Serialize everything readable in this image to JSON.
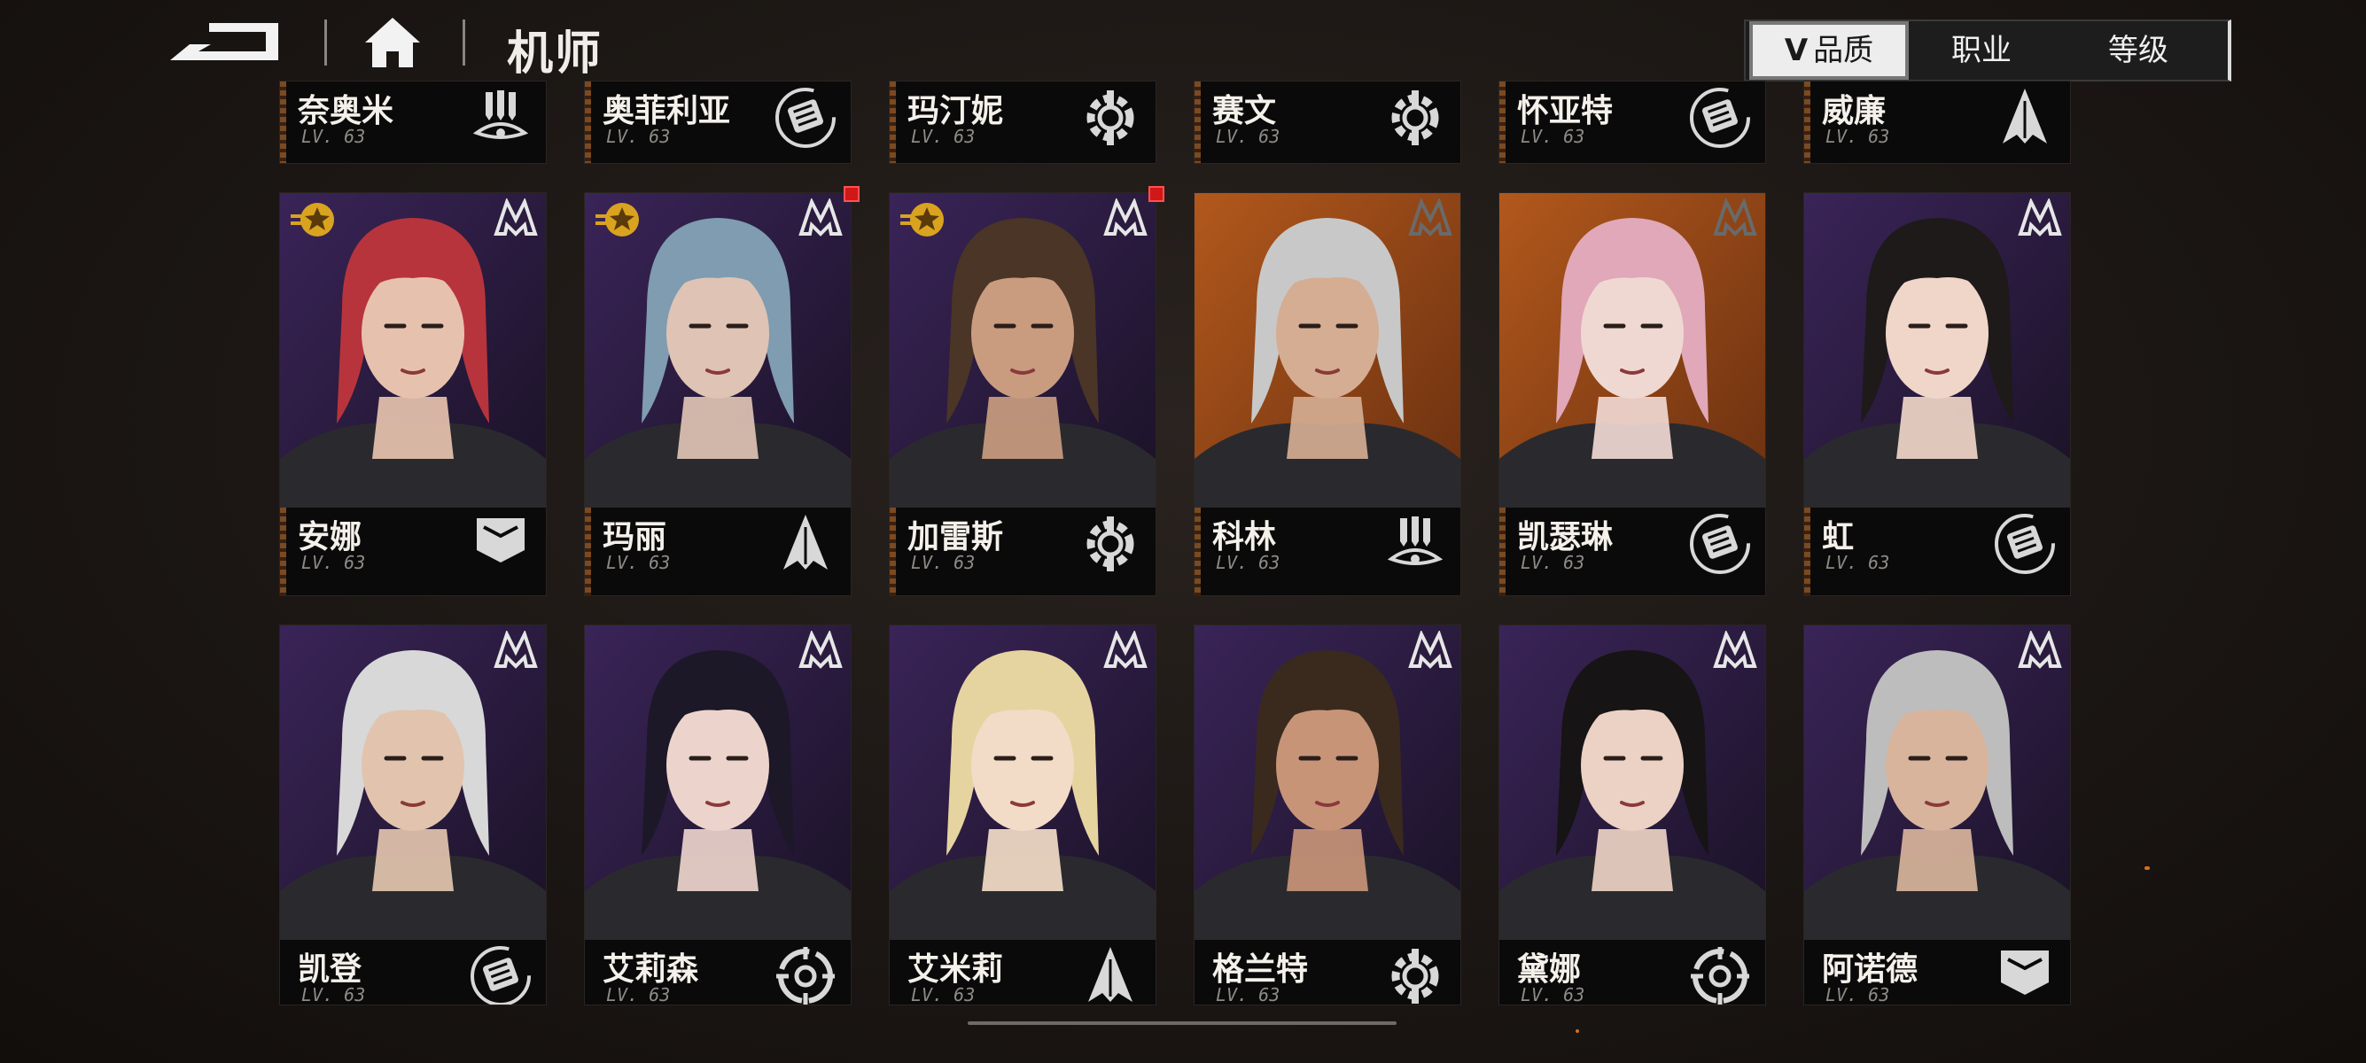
{
  "header": {
    "title": "机师",
    "back_icon": "back-arrow-icon",
    "home_icon": "home-icon"
  },
  "sort": {
    "tabs": [
      {
        "label": "品质",
        "active": true,
        "indicator": "V"
      },
      {
        "label": "职业",
        "active": false
      },
      {
        "label": "等级",
        "active": false
      }
    ]
  },
  "colors": {
    "purple_bg": "#3a2458",
    "orange_bg": "#b2581c",
    "gold_rank": "#d9a320",
    "alert_red": "#d01818"
  },
  "roster": {
    "row1": [
      {
        "name": "奈奥米",
        "level": "LV. 63",
        "class_icon": "triple-missile-icon"
      },
      {
        "name": "奥菲利亚",
        "level": "LV. 63",
        "class_icon": "fist-icon"
      },
      {
        "name": "玛汀妮",
        "level": "LV. 63",
        "class_icon": "wrench-gear-icon"
      },
      {
        "name": "赛文",
        "level": "LV. 63",
        "class_icon": "wrench-gear-icon"
      },
      {
        "name": "怀亚特",
        "level": "LV. 63",
        "class_icon": "fist-icon"
      },
      {
        "name": "威廉",
        "level": "LV. 63",
        "class_icon": "spike-icon"
      }
    ],
    "row2": [
      {
        "name": "安娜",
        "level": "LV. 63",
        "class_icon": "shield-chevron-icon",
        "rank_star": true,
        "new": false,
        "bg": "purple",
        "hair": "#b8343c",
        "skin": "#e6c2ae"
      },
      {
        "name": "玛丽",
        "level": "LV. 63",
        "class_icon": "spike-icon",
        "rank_star": true,
        "new": true,
        "bg": "purple",
        "hair": "#7f9cb0",
        "skin": "#dfc3b4"
      },
      {
        "name": "加雷斯",
        "level": "LV. 63",
        "class_icon": "wrench-gear-icon",
        "rank_star": true,
        "new": true,
        "bg": "purple",
        "hair": "#4a3526",
        "skin": "#c99c80"
      },
      {
        "name": "科林",
        "level": "LV. 63",
        "class_icon": "triple-missile-icon",
        "rank_star": false,
        "new": false,
        "bg": "orange",
        "hair": "#c8c8c8",
        "skin": "#d4ad92"
      },
      {
        "name": "凯瑟琳",
        "level": "LV. 63",
        "class_icon": "fist-icon",
        "rank_star": false,
        "new": false,
        "bg": "orange",
        "hair": "#e0a8b8",
        "skin": "#f0d8d2"
      },
      {
        "name": "虹",
        "level": "LV. 63",
        "class_icon": "fist-icon",
        "rank_star": false,
        "new": false,
        "bg": "purple",
        "hair": "#1e1a1a",
        "skin": "#efd6c8"
      }
    ],
    "row3": [
      {
        "name": "凯登",
        "level": "LV. 63",
        "class_icon": "fist-icon",
        "bg": "purple",
        "hair": "#d8d8d8",
        "skin": "#e2c4ae"
      },
      {
        "name": "艾莉森",
        "level": "LV. 63",
        "class_icon": "crosshair-icon",
        "bg": "purple",
        "hair": "#1c1828",
        "skin": "#ecd4cc"
      },
      {
        "name": "艾米莉",
        "level": "LV. 63",
        "class_icon": "spike-icon",
        "bg": "purple",
        "hair": "#e6d4a0",
        "skin": "#f2dcc8"
      },
      {
        "name": "格兰特",
        "level": "LV. 63",
        "class_icon": "wrench-gear-icon",
        "bg": "purple",
        "hair": "#3a2a1e",
        "skin": "#c89478"
      },
      {
        "name": "黛娜",
        "level": "LV. 63",
        "class_icon": "crosshair-icon",
        "bg": "purple",
        "hair": "#161414",
        "skin": "#ecd2c4"
      },
      {
        "name": "阿诺德",
        "level": "LV. 63",
        "class_icon": "shield-chevron-icon",
        "bg": "purple",
        "hair": "#bdbdbd",
        "skin": "#d8b49c"
      }
    ]
  }
}
